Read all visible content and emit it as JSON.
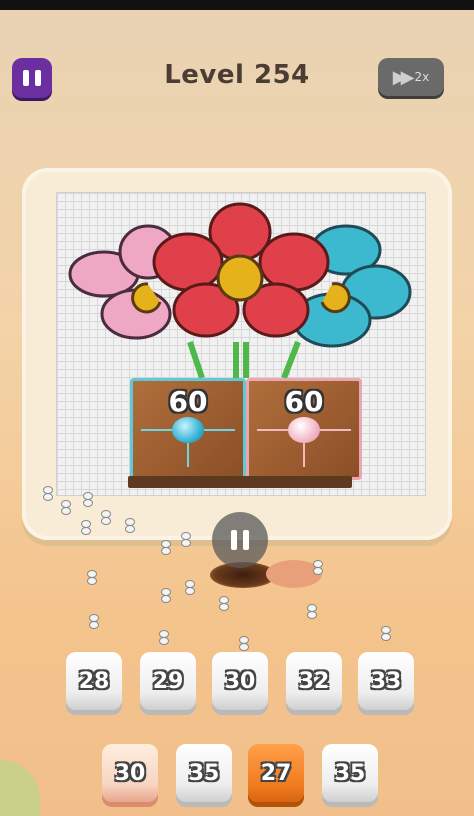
{
  "header": {
    "level_title": "Level 254",
    "speed_label": "2x"
  },
  "boxes": [
    {
      "color": "#5ec9d9",
      "count": "60"
    },
    {
      "color": "#eaa7b2",
      "count": "60"
    }
  ],
  "queue_tiles": [
    "28",
    "29",
    "30",
    "32",
    "33"
  ],
  "bottom_tiles": [
    "30",
    "35",
    "27",
    "35"
  ],
  "colors": {
    "blue_petal": "#3cb9cf",
    "pink_petal": "#eea8c3",
    "red_petal": "#e0404a",
    "center_yellow": "#e6b21c",
    "stem_green": "#4fb84a",
    "accent_purple": "#6b2fa0",
    "tile_orange": "#f17c20"
  }
}
